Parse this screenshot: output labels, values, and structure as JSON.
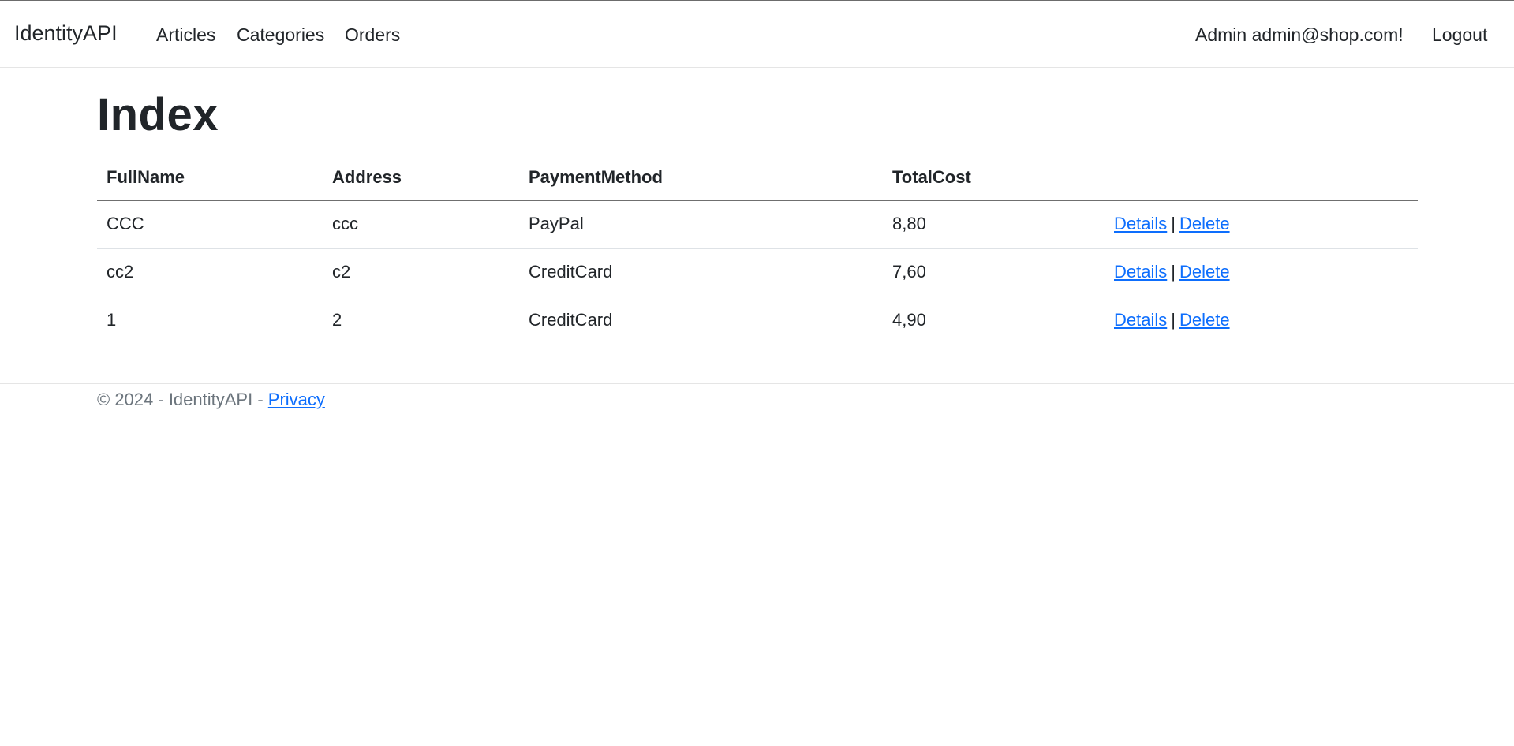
{
  "navbar": {
    "brand": "IdentityAPI",
    "links": [
      "Articles",
      "Categories",
      "Orders"
    ],
    "user_greeting": "Admin admin@shop.com!",
    "logout": "Logout"
  },
  "page": {
    "title": "Index"
  },
  "table": {
    "columns": [
      "FullName",
      "Address",
      "PaymentMethod",
      "TotalCost"
    ],
    "rows": [
      {
        "full_name": "CCC",
        "address": "ccc",
        "payment_method": "PayPal",
        "total_cost": "8,80"
      },
      {
        "full_name": "cc2",
        "address": "c2",
        "payment_method": "CreditCard",
        "total_cost": "7,60"
      },
      {
        "full_name": "1",
        "address": "2",
        "payment_method": "CreditCard",
        "total_cost": "4,90"
      }
    ],
    "action_details": "Details",
    "action_separator": "|",
    "action_delete": "Delete"
  },
  "footer": {
    "text": "© 2024 - IdentityAPI - ",
    "privacy": "Privacy"
  },
  "colors": {
    "link": "#0d6efd",
    "text": "#212529",
    "muted": "#6c757d"
  }
}
